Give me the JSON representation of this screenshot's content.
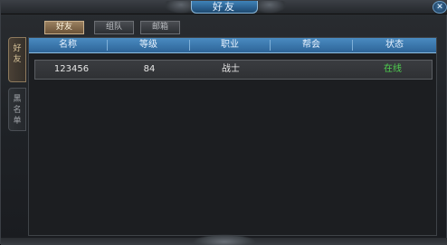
{
  "window": {
    "title": "好友",
    "close_glyph": "✕"
  },
  "top_tabs": [
    {
      "label": "好友",
      "active": true
    },
    {
      "label": "组队",
      "active": false
    },
    {
      "label": "邮箱",
      "active": false
    }
  ],
  "side_tabs": [
    {
      "label_chars": [
        "好",
        "友"
      ],
      "active": true
    },
    {
      "label_chars": [
        "黑",
        "名",
        "单"
      ],
      "active": false
    }
  ],
  "table": {
    "columns": [
      "名称",
      "等级",
      "职业",
      "帮会",
      "状态"
    ],
    "rows": [
      {
        "name": "123456",
        "level": "84",
        "class": "战士",
        "guild": "",
        "status": "在线"
      }
    ]
  },
  "colors": {
    "header_blue": "#2d6497",
    "online_green": "#4fd14f",
    "active_tab_bronze": "#9a8060"
  }
}
